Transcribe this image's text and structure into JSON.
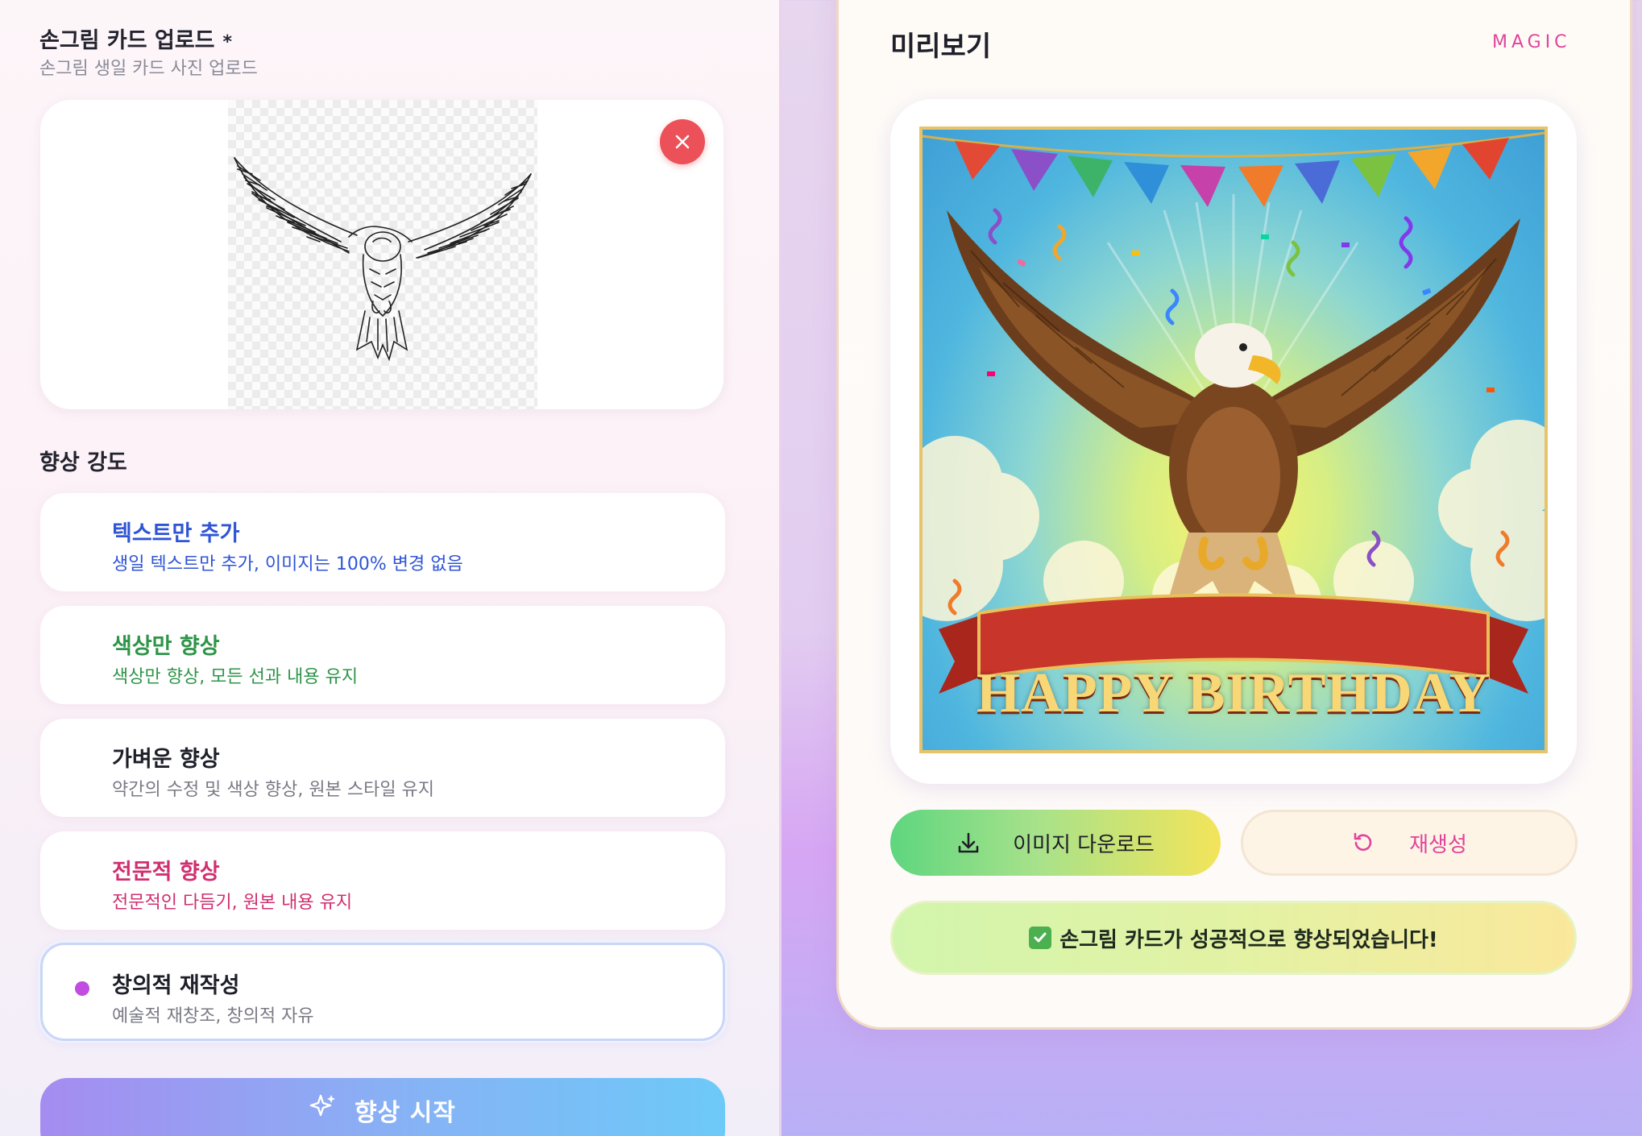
{
  "upload": {
    "title": "손그림 카드 업로드",
    "required_mark": "*",
    "subtitle": "손그림 생일 카드 사진 업로드"
  },
  "intensity": {
    "label": "향상 강도",
    "options": [
      {
        "title": "텍스트만 추가",
        "desc": "생일 텍스트만 추가, 이미지는 100% 변경 없음",
        "color": "#2f54d6",
        "selected": false
      },
      {
        "title": "색상만 향상",
        "desc": "색상만 향상, 모든 선과 내용 유지",
        "color": "#2e9448",
        "selected": false
      },
      {
        "title": "가벼운 향상",
        "desc": "약간의 수정 및 색상 향상, 원본 스타일 유지",
        "color": "#1f1f2a",
        "desc_color": "#7a7a86",
        "selected": false
      },
      {
        "title": "전문적 향상",
        "desc": "전문적인 다듬기, 원본 내용 유지",
        "color": "#d02f6f",
        "selected": false
      },
      {
        "title": "창의적 재작성",
        "desc": "예술적 재창조, 창의적 자유",
        "color": "#1f1f2a",
        "desc_color": "#7a7a86",
        "selected": true
      }
    ]
  },
  "start_button": {
    "label": "향상 시작",
    "icon": "sparkles-icon"
  },
  "preview": {
    "title": "미리보기",
    "badge": "MAGIC",
    "card_text": "HAPPY BIRTHDAY"
  },
  "actions": {
    "download_label": "이미지 다운로드",
    "download_icon": "download-icon",
    "regenerate_label": "재생성",
    "regenerate_icon": "refresh-icon"
  },
  "status": {
    "message": "손그림 카드가 성공적으로 향상되었습니다!",
    "icon": "check-box-icon"
  },
  "colors": {
    "accent_pink": "#e0449a",
    "remove_red": "#ec5059",
    "selected_dot": "#c04de0"
  }
}
